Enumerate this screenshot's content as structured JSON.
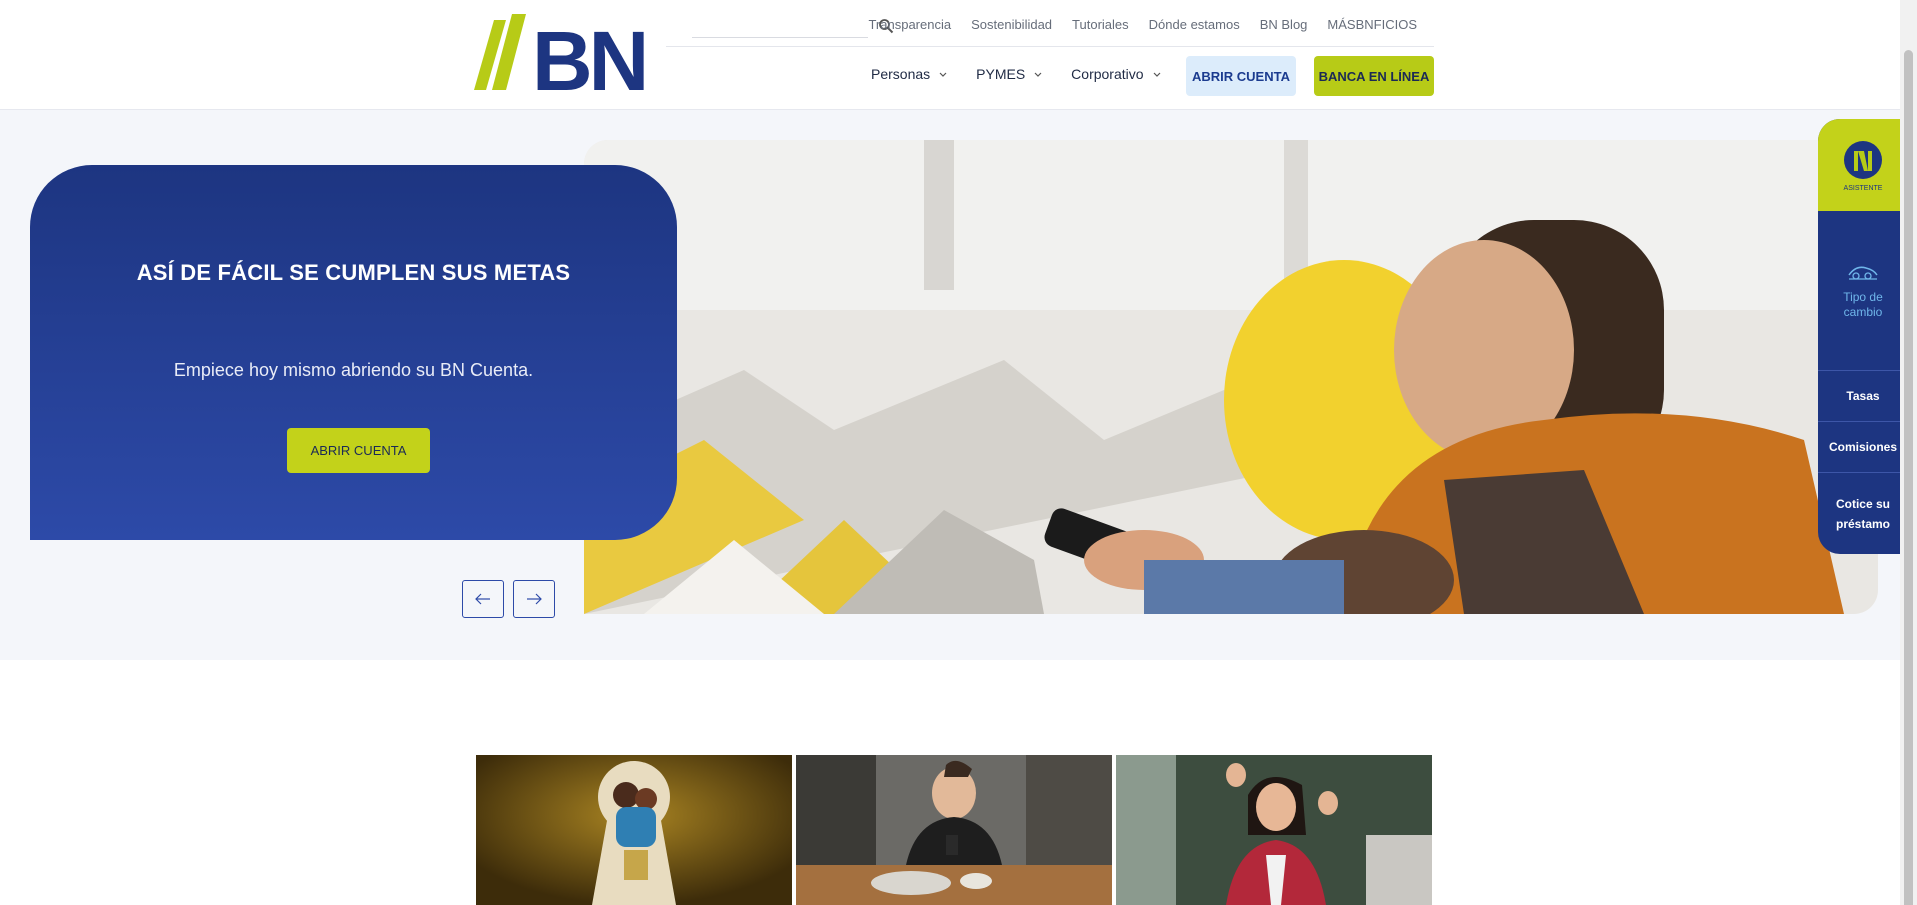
{
  "header": {
    "logo_text": "BN",
    "search": {
      "placeholder": ""
    },
    "top_links": [
      "Transparencia",
      "Sostenibilidad",
      "Tutoriales",
      "Dónde estamos",
      "BN Blog",
      "MÁSBNFICIOS"
    ],
    "nav": [
      {
        "label": "Personas"
      },
      {
        "label": "PYMES"
      },
      {
        "label": "Corporativo"
      }
    ],
    "open_account_label": "ABRIR CUENTA",
    "online_banking_label": "BANCA EN LÍNEA"
  },
  "hero": {
    "title": "ASÍ DE FÁCIL SE CUMPLEN SUS METAS",
    "subtitle": "Empiece hoy mismo abriendo su BN Cuenta.",
    "cta_label": "ABRIR CUENTA"
  },
  "side_widget": {
    "assistant_label": "ASISTENTE",
    "exchange_label": "Tipo de cambio",
    "rates_label": "Tasas",
    "fees_label": "Comisiones",
    "loan_label": "Cotice su préstamo"
  },
  "colors": {
    "brand_blue": "#1d3581",
    "brand_green": "#b7cb17",
    "light_blue": "#dcecfb"
  }
}
